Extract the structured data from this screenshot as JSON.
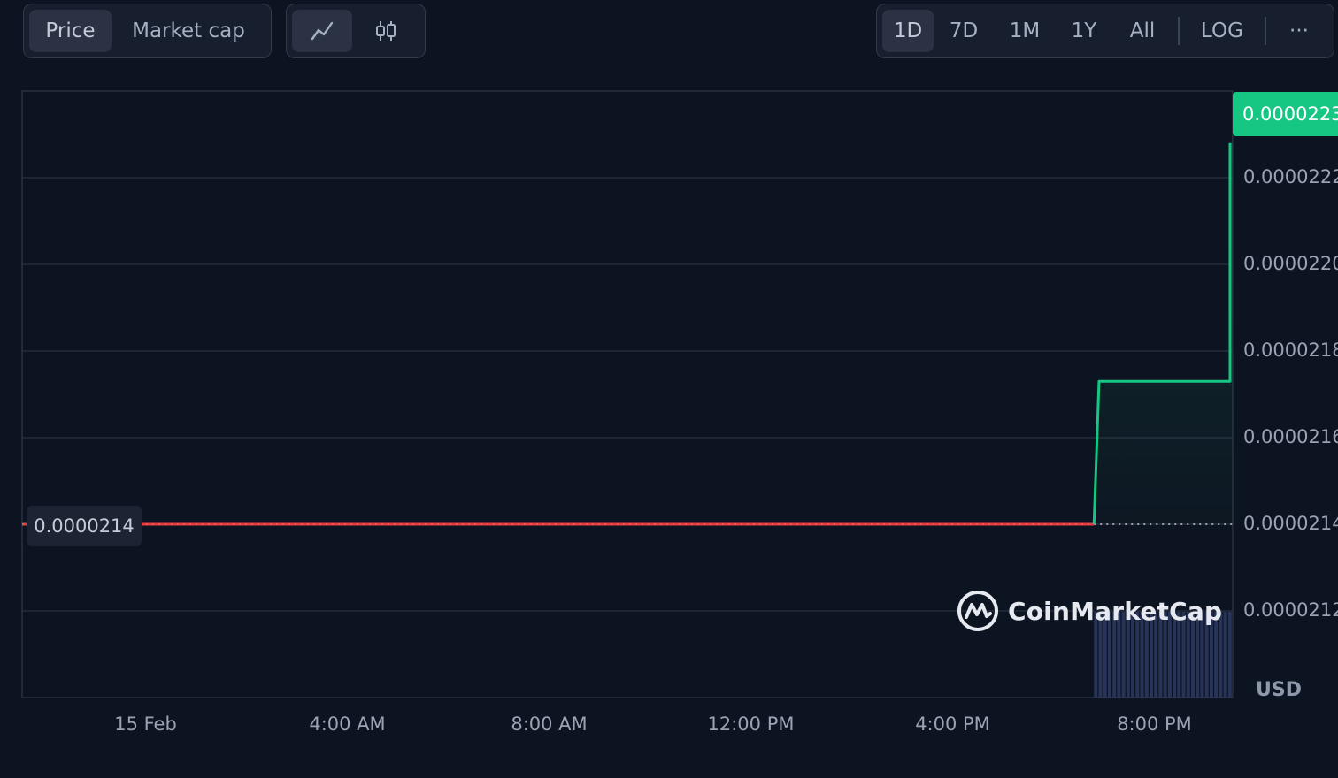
{
  "toolbar": {
    "metric_tabs": [
      {
        "label": "Price",
        "active": true
      },
      {
        "label": "Market cap",
        "active": false
      }
    ],
    "chart_modes": [
      {
        "icon": "line-chart-icon",
        "active": true
      },
      {
        "icon": "candlestick-icon",
        "active": false
      }
    ],
    "ranges": [
      {
        "label": "1D",
        "active": true
      },
      {
        "label": "7D",
        "active": false
      },
      {
        "label": "1M",
        "active": false
      },
      {
        "label": "1Y",
        "active": false
      },
      {
        "label": "All",
        "active": false
      }
    ],
    "log_label": "LOG",
    "more_label": "···"
  },
  "watermark": {
    "text": "CoinMarketCap",
    "icon": "coinmarketcap-logo-icon"
  },
  "currency_label": "USD",
  "colors": {
    "background": "#0d1421",
    "up": "#16c784",
    "down": "#ea3943",
    "grid": "#2a3142",
    "volume": "#2d3860"
  },
  "chart_data": {
    "type": "line",
    "x_tick_labels": [
      "15 Feb",
      "4:00 AM",
      "8:00 AM",
      "12:00 PM",
      "4:00 PM",
      "8:00 PM"
    ],
    "x_tick_hours": [
      0,
      4,
      8,
      12,
      16,
      20
    ],
    "xlim_hours": [
      -2.5,
      21.5
    ],
    "ylim": [
      2.1e-05,
      2.24e-05
    ],
    "y_ticks": [
      2.12e-05,
      2.14e-05,
      2.16e-05,
      2.18e-05,
      2.2e-05,
      2.22e-05
    ],
    "y_tick_labels": [
      "0.0000212",
      "0.0000214",
      "0.0000216",
      "0.0000218",
      "0.0000220",
      "0.0000222"
    ],
    "open_value": 2.14e-05,
    "open_label": "0.0000214",
    "last_value": 2.228e-05,
    "last_label": "0.0000223",
    "series": [
      {
        "x_hours": [
          -2.5,
          18.75,
          18.85,
          21.45,
          21.52,
          21.5
        ],
        "values": [
          2.14e-05,
          2.14e-05,
          2.173e-05,
          2.173e-05,
          2.228e-05,
          2.228e-05
        ]
      }
    ],
    "volume": {
      "x_start_hours": 18.75,
      "x_end_hours": 21.5,
      "bar_count": 30
    },
    "grid": true
  }
}
